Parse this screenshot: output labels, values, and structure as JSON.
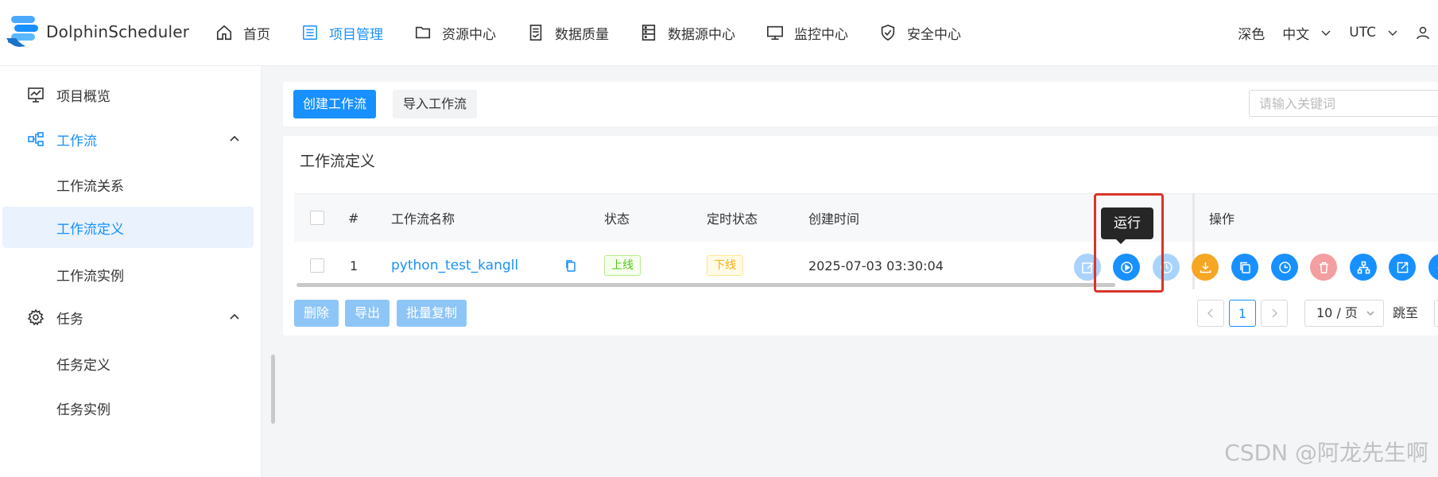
{
  "app": {
    "name": "DolphinScheduler"
  },
  "nav": [
    {
      "label": "首页",
      "icon": "home-icon",
      "active": false
    },
    {
      "label": "项目管理",
      "icon": "project-list-icon",
      "active": true
    },
    {
      "label": "资源中心",
      "icon": "folder-icon",
      "active": false
    },
    {
      "label": "数据质量",
      "icon": "data-quality-icon",
      "active": false
    },
    {
      "label": "数据源中心",
      "icon": "datasource-icon",
      "active": false
    },
    {
      "label": "监控中心",
      "icon": "monitor-icon",
      "active": false
    },
    {
      "label": "安全中心",
      "icon": "shield-icon",
      "active": false
    }
  ],
  "header_right": {
    "theme": "深色",
    "language": "中文",
    "timezone": "UTC"
  },
  "sidebar": {
    "items": [
      {
        "label": "项目概览",
        "icon": "overview-icon"
      },
      {
        "label": "工作流",
        "icon": "workflow-icon",
        "expanded": true
      },
      {
        "label": "工作流关系"
      },
      {
        "label": "工作流定义",
        "selected": true
      },
      {
        "label": "工作流实例"
      },
      {
        "label": "任务",
        "icon": "gear-icon",
        "expanded": true
      },
      {
        "label": "任务定义"
      },
      {
        "label": "任务实例"
      }
    ]
  },
  "toolbar": {
    "create_label": "创建工作流",
    "import_label": "导入工作流",
    "search_placeholder": "请输入关键词"
  },
  "table": {
    "title": "工作流定义",
    "columns": [
      "#",
      "工作流名称",
      "状态",
      "定时状态",
      "创建时间",
      "操作"
    ],
    "rows": [
      {
        "index": "1",
        "name": "python_test_kangll",
        "status": "上线",
        "schedule_status": "下线",
        "created_at": "2025-07-03 03:30:04"
      }
    ],
    "operation_icons": [
      "edit-icon",
      "run-icon",
      "schedule-icon",
      "download-icon",
      "copy-icon",
      "timing-icon",
      "delete-icon",
      "tree-icon",
      "export-icon",
      "more-icon"
    ],
    "tooltip": "运行"
  },
  "footer": {
    "delete_label": "删除",
    "export_label": "导出",
    "batch_copy_label": "批量复制",
    "current_page": "1",
    "page_size": "10 / 页",
    "jump_label": "跳至"
  },
  "colors": {
    "accent": "#1890ff",
    "online_tag": "#52c41a",
    "offline_tag": "#faad14",
    "op_orange": "#f5a623",
    "op_red_disabled": "#f39ea0"
  },
  "watermark": "CSDN @阿龙先生啊"
}
